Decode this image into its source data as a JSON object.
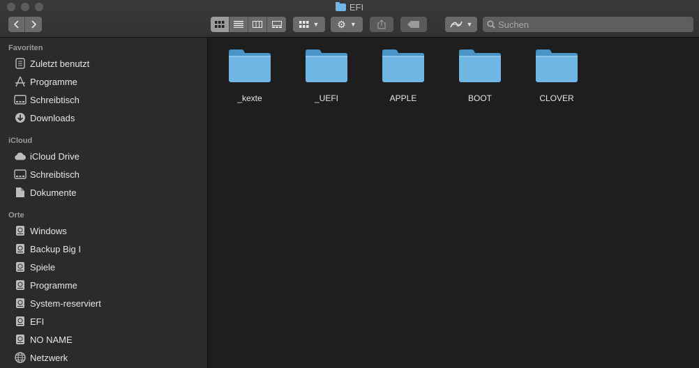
{
  "window": {
    "title": "EFI"
  },
  "search": {
    "placeholder": "Suchen"
  },
  "sidebar": {
    "sections": [
      {
        "title": "Favoriten",
        "items": [
          {
            "label": "Zuletzt benutzt",
            "icon": "recents-icon"
          },
          {
            "label": "Programme",
            "icon": "applications-icon"
          },
          {
            "label": "Schreibtisch",
            "icon": "desktop-icon"
          },
          {
            "label": "Downloads",
            "icon": "downloads-icon"
          }
        ]
      },
      {
        "title": "iCloud",
        "items": [
          {
            "label": "iCloud Drive",
            "icon": "cloud-icon"
          },
          {
            "label": "Schreibtisch",
            "icon": "desktop-icon"
          },
          {
            "label": "Dokumente",
            "icon": "documents-icon"
          }
        ]
      },
      {
        "title": "Orte",
        "items": [
          {
            "label": "Windows",
            "icon": "disk-icon"
          },
          {
            "label": "Backup Big I",
            "icon": "disk-icon"
          },
          {
            "label": "Spiele",
            "icon": "disk-icon"
          },
          {
            "label": "Programme",
            "icon": "disk-icon"
          },
          {
            "label": "System-reserviert",
            "icon": "disk-icon"
          },
          {
            "label": "EFI",
            "icon": "disk-icon"
          },
          {
            "label": "NO NAME",
            "icon": "disk-icon"
          },
          {
            "label": "Netzwerk",
            "icon": "network-icon"
          }
        ]
      }
    ]
  },
  "folders": [
    {
      "name": "_kexte"
    },
    {
      "name": "_UEFI"
    },
    {
      "name": "APPLE"
    },
    {
      "name": "BOOT"
    },
    {
      "name": "CLOVER"
    }
  ],
  "colors": {
    "folder_light": "#6fb6e4",
    "folder_dark": "#4a94c8",
    "sidebar_bg": "#2b2b2b",
    "content_bg": "#1e1e1e"
  }
}
